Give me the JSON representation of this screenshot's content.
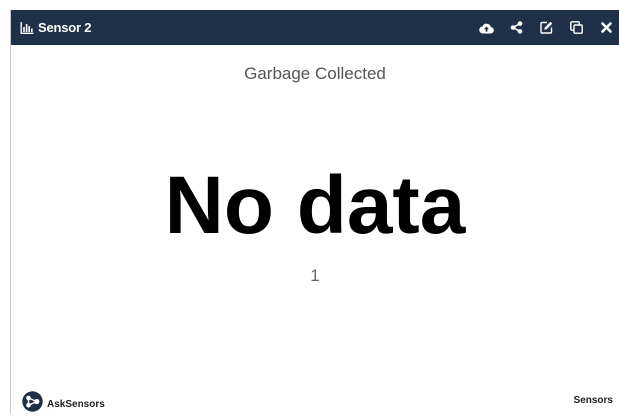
{
  "header": {
    "title": "Sensor 2",
    "background": "#1e3148",
    "title_icon": "bar-chart-icon",
    "actions": [
      {
        "icon": "cloud-upload-icon"
      },
      {
        "icon": "share-icon"
      },
      {
        "icon": "edit-icon"
      },
      {
        "icon": "copy-icon"
      },
      {
        "icon": "close-icon"
      }
    ]
  },
  "widget": {
    "metric_name": "Garbage Collected",
    "value": "No data",
    "sub_value": "1"
  },
  "footer": {
    "brand_icon": "asksensors-logo-icon",
    "brand_name": "AskSensors",
    "link_label": "Sensors"
  }
}
